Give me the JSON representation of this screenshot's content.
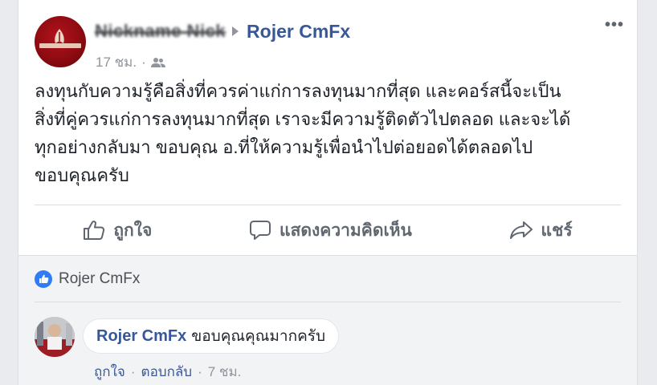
{
  "post": {
    "author_blurred": "Nickname Nick",
    "target_name": "Rojer CmFx",
    "time": "17 ชม.",
    "separator": "·",
    "audience_icon": "friends-icon",
    "more_label": "•••",
    "body_lines": [
      "ลงทุนกับความรู้คือสิ่งที่ควรค่าแก่การลงทุนมากที่สุด และคอร์สนี้จะเป็น",
      "สิ่งที่คู่ควรแก่การลงทุนมากที่สุด เราจะมีความรู้ติดตัวไปตลอด และจะได้",
      "ทุกอย่างกลับมา ขอบคุณ อ.ที่ให้ความรู้เพื่อนำไปต่อยอดได้ตลอดไป",
      "ขอบคุณครับ"
    ]
  },
  "actions": {
    "like_label": "ถูกใจ",
    "comment_label": "แสดงความคิดเห็น",
    "share_label": "แชร์"
  },
  "likes": {
    "name": "Rojer CmFx"
  },
  "comment": {
    "author": "Rojer CmFx",
    "text": "ขอบคุณคุณมากครับ",
    "like_label": "ถูกใจ",
    "reply_label": "ตอบกลับ",
    "separator": "·",
    "time": "7 ชม."
  },
  "colors": {
    "link_blue": "#365899",
    "like_blue": "#2f7cf6",
    "meta_gray": "#90949c",
    "page_bg": "#e9ebee"
  }
}
